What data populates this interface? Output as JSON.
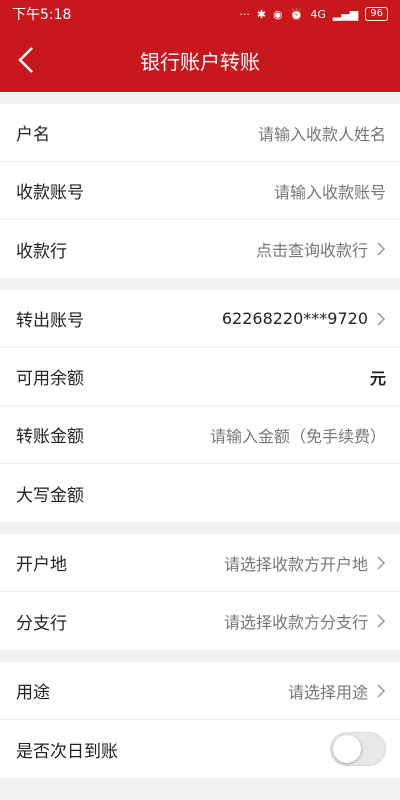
{
  "status_bar": {
    "time": "下午5:18",
    "network": "4G",
    "battery": "96"
  },
  "header": {
    "title": "银行账户转账"
  },
  "payee": {
    "name_label": "户名",
    "name_placeholder": "请输入收款人姓名",
    "account_label": "收款账号",
    "account_placeholder": "请输入收款账号",
    "bank_label": "收款行",
    "bank_value": "点击查询收款行"
  },
  "payer": {
    "account_label": "转出账号",
    "account_value": "62268220***9720",
    "balance_label": "可用余额",
    "balance_unit": "元",
    "amount_label": "转账金额",
    "amount_placeholder": "请输入金额（免手续费）",
    "uppercase_label": "大写金额"
  },
  "location": {
    "open_place_label": "开户地",
    "open_place_value": "请选择收款方开户地",
    "branch_label": "分支行",
    "branch_value": "请选择收款方分支行"
  },
  "extra": {
    "purpose_label": "用途",
    "purpose_value": "请选择用途",
    "next_day_label": "是否次日到账",
    "next_day_enabled": false
  }
}
